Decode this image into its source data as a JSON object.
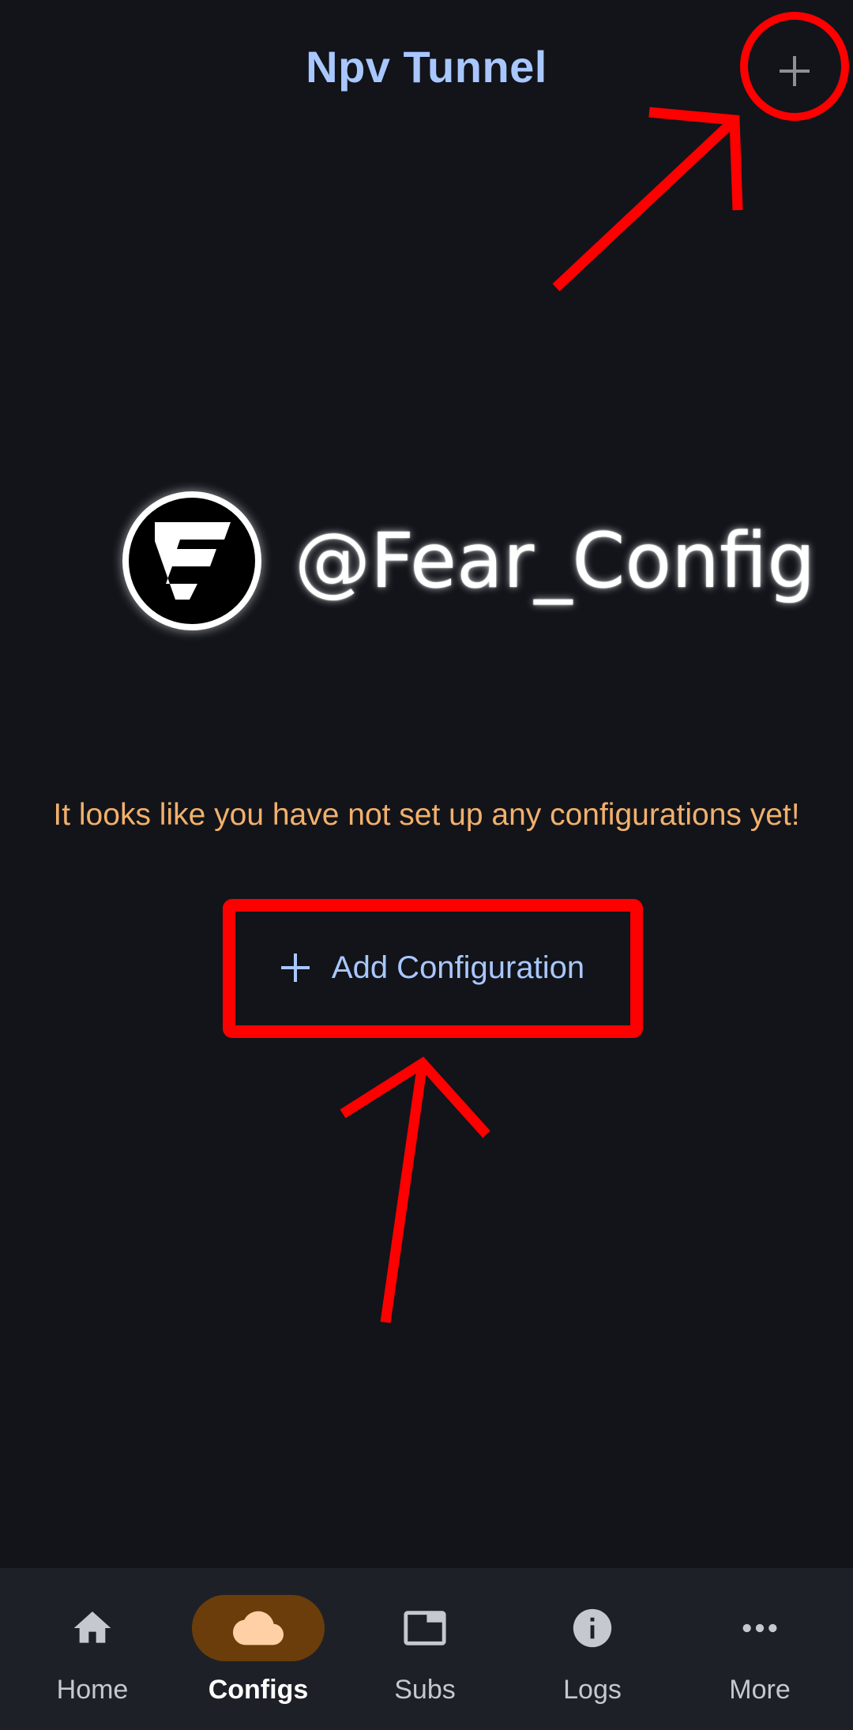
{
  "app_bar": {
    "title": "Npv Tunnel",
    "add_icon": "plus-icon"
  },
  "brand": {
    "name": "@Fear_Config",
    "logo_icon": "fear-config-logo"
  },
  "empty_state": {
    "message": "It looks like you have not set up any configurations yet!",
    "add_button_label": "Add Configuration",
    "add_button_icon": "plus-icon"
  },
  "bottom_nav": {
    "items": [
      {
        "label": "Home",
        "icon": "home-icon",
        "active": false
      },
      {
        "label": "Configs",
        "icon": "cloud-icon",
        "active": true
      },
      {
        "label": "Subs",
        "icon": "tab-icon",
        "active": false
      },
      {
        "label": "Logs",
        "icon": "info-icon",
        "active": false
      },
      {
        "label": "More",
        "icon": "more-horiz-icon",
        "active": false
      }
    ]
  },
  "colors": {
    "background": "#12141a",
    "title": "#a9c7ff",
    "message": "#f2b06b",
    "nav_background": "#1e2027",
    "nav_active_pill": "#6b3d0a",
    "annotation_red": "#ff0000"
  }
}
